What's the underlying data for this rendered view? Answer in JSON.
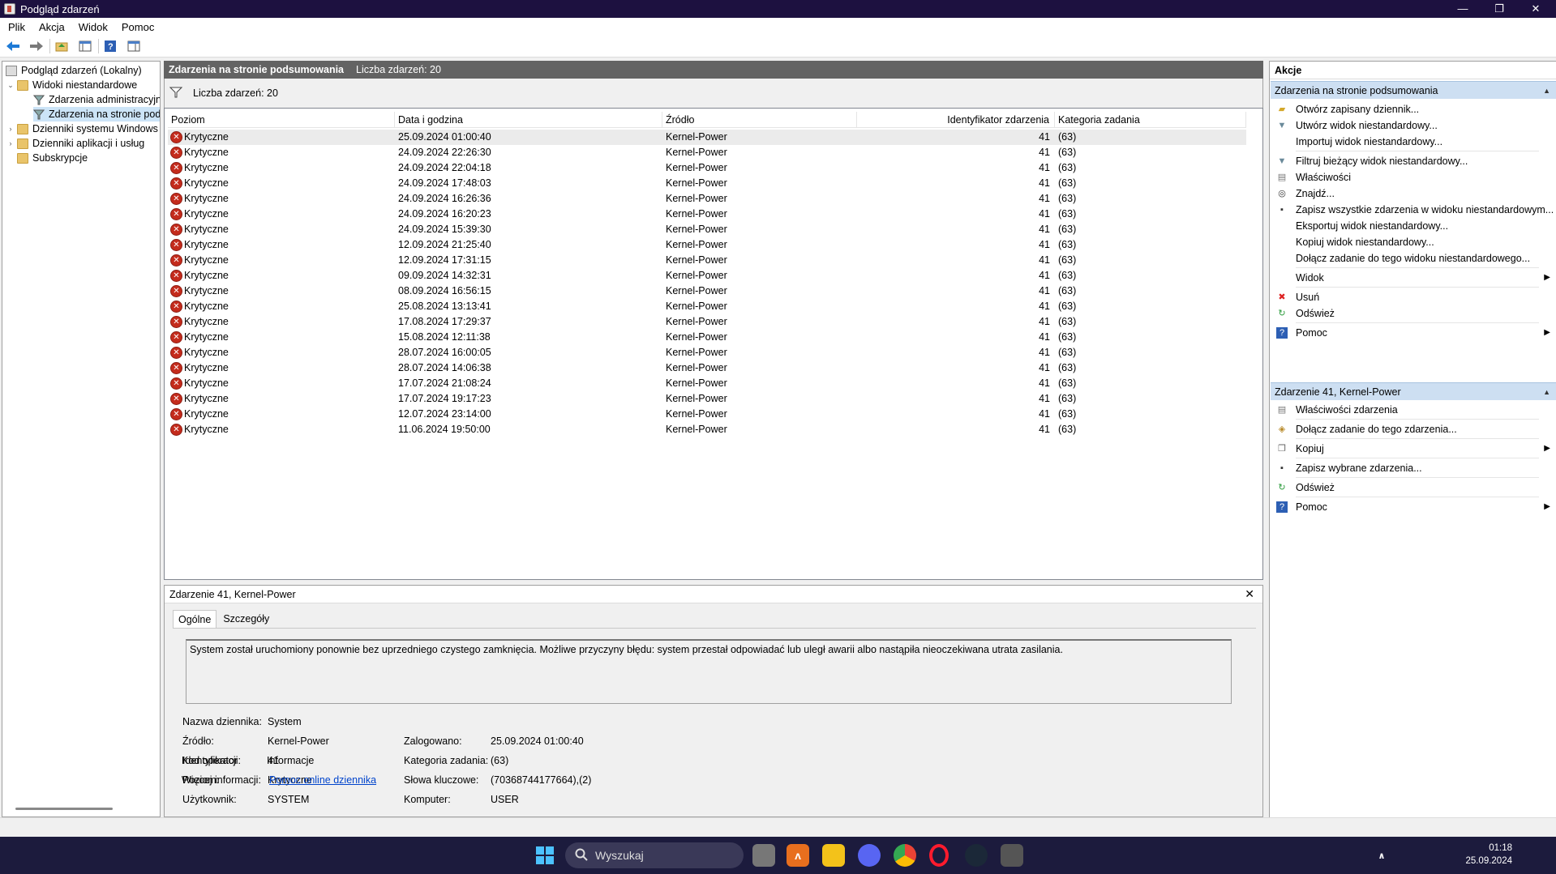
{
  "window": {
    "title": "Podgląd zdarzeń",
    "minimize": "—",
    "maximize": "❐",
    "close": "✕"
  },
  "menu": [
    "Plik",
    "Akcja",
    "Widok",
    "Pomoc"
  ],
  "tree": {
    "root": "Podgląd zdarzeń (Lokalny)",
    "custom_views": "Widoki niestandardowe",
    "admin_events": "Zdarzenia administracyjn",
    "summary_events": "Zdarzenia na stronie pod",
    "windows_logs": "Dzienniki systemu Windows",
    "app_logs": "Dzienniki aplikacji i usług",
    "subscriptions": "Subskrypcje"
  },
  "center": {
    "header_title": "Zdarzenia na stronie podsumowania",
    "header_count": "Liczba zdarzeń: 20",
    "filter_text": "Liczba zdarzeń: 20"
  },
  "columns": [
    "Poziom",
    "Data i godzina",
    "Źródło",
    "Identyfikator zdarzenia",
    "Kategoria zadania"
  ],
  "events": [
    {
      "level": "Krytyczne",
      "datetime": "25.09.2024 01:00:40",
      "source": "Kernel-Power",
      "id": "41",
      "category": "(63)"
    },
    {
      "level": "Krytyczne",
      "datetime": "24.09.2024 22:26:30",
      "source": "Kernel-Power",
      "id": "41",
      "category": "(63)"
    },
    {
      "level": "Krytyczne",
      "datetime": "24.09.2024 22:04:18",
      "source": "Kernel-Power",
      "id": "41",
      "category": "(63)"
    },
    {
      "level": "Krytyczne",
      "datetime": "24.09.2024 17:48:03",
      "source": "Kernel-Power",
      "id": "41",
      "category": "(63)"
    },
    {
      "level": "Krytyczne",
      "datetime": "24.09.2024 16:26:36",
      "source": "Kernel-Power",
      "id": "41",
      "category": "(63)"
    },
    {
      "level": "Krytyczne",
      "datetime": "24.09.2024 16:20:23",
      "source": "Kernel-Power",
      "id": "41",
      "category": "(63)"
    },
    {
      "level": "Krytyczne",
      "datetime": "24.09.2024 15:39:30",
      "source": "Kernel-Power",
      "id": "41",
      "category": "(63)"
    },
    {
      "level": "Krytyczne",
      "datetime": "12.09.2024 21:25:40",
      "source": "Kernel-Power",
      "id": "41",
      "category": "(63)"
    },
    {
      "level": "Krytyczne",
      "datetime": "12.09.2024 17:31:15",
      "source": "Kernel-Power",
      "id": "41",
      "category": "(63)"
    },
    {
      "level": "Krytyczne",
      "datetime": "09.09.2024 14:32:31",
      "source": "Kernel-Power",
      "id": "41",
      "category": "(63)"
    },
    {
      "level": "Krytyczne",
      "datetime": "08.09.2024 16:56:15",
      "source": "Kernel-Power",
      "id": "41",
      "category": "(63)"
    },
    {
      "level": "Krytyczne",
      "datetime": "25.08.2024 13:13:41",
      "source": "Kernel-Power",
      "id": "41",
      "category": "(63)"
    },
    {
      "level": "Krytyczne",
      "datetime": "17.08.2024 17:29:37",
      "source": "Kernel-Power",
      "id": "41",
      "category": "(63)"
    },
    {
      "level": "Krytyczne",
      "datetime": "15.08.2024 12:11:38",
      "source": "Kernel-Power",
      "id": "41",
      "category": "(63)"
    },
    {
      "level": "Krytyczne",
      "datetime": "28.07.2024 16:00:05",
      "source": "Kernel-Power",
      "id": "41",
      "category": "(63)"
    },
    {
      "level": "Krytyczne",
      "datetime": "28.07.2024 14:06:38",
      "source": "Kernel-Power",
      "id": "41",
      "category": "(63)"
    },
    {
      "level": "Krytyczne",
      "datetime": "17.07.2024 21:08:24",
      "source": "Kernel-Power",
      "id": "41",
      "category": "(63)"
    },
    {
      "level": "Krytyczne",
      "datetime": "17.07.2024 19:17:23",
      "source": "Kernel-Power",
      "id": "41",
      "category": "(63)"
    },
    {
      "level": "Krytyczne",
      "datetime": "12.07.2024 23:14:00",
      "source": "Kernel-Power",
      "id": "41",
      "category": "(63)"
    },
    {
      "level": "Krytyczne",
      "datetime": "11.06.2024 19:50:00",
      "source": "Kernel-Power",
      "id": "41",
      "category": "(63)"
    }
  ],
  "detail": {
    "title": "Zdarzenie 41, Kernel-Power",
    "tab_general": "Ogólne",
    "tab_details": "Szczegóły",
    "description": "System został uruchomiony ponownie bez uprzedniego czystego zamknięcia. Możliwe przyczyny błędu: system przestał odpowiadać lub uległ awarii albo nastąpiła nieoczekiwana utrata zasilania.",
    "log_name_label": "Nazwa dziennika:",
    "log_name": "System",
    "source_label": "Źródło:",
    "source": "Kernel-Power",
    "logged_label": "Zalogowano:",
    "logged": "25.09.2024 01:00:40",
    "id_label": "Identyfikator",
    "id": "41",
    "category_label": "Kategoria zadania:",
    "category": "(63)",
    "level_label": "Poziom:",
    "level": "Krytyczne",
    "keywords_label": "Słowa kluczowe:",
    "keywords": "(70368744177664),(2)",
    "user_label": "Użytkownik:",
    "user": "SYSTEM",
    "computer_label": "Komputer:",
    "computer": "USER",
    "opcode_label": "Kod operacji:",
    "opcode": "Informacje",
    "more_info_label": "Więcej informacji:",
    "more_info_link": "Pomoc online dziennika"
  },
  "actions": {
    "header": "Akcje",
    "section1": "Zdarzenia na stronie podsumowania",
    "items1": [
      {
        "label": "Otwórz zapisany dziennik...",
        "icon": "open-folder-icon"
      },
      {
        "label": "Utwórz widok niestandardowy...",
        "icon": "filter-icon"
      },
      {
        "label": "Importuj widok niestandardowy...",
        "icon": ""
      },
      {
        "label": "Filtruj bieżący widok niestandardowy...",
        "icon": "filter-icon"
      },
      {
        "label": "Właściwości",
        "icon": "properties-icon"
      },
      {
        "label": "Znajdź...",
        "icon": "binoculars-icon"
      },
      {
        "label": "Zapisz wszystkie zdarzenia w widoku niestandardowym...",
        "icon": "save-icon"
      },
      {
        "label": "Eksportuj widok niestandardowy...",
        "icon": ""
      },
      {
        "label": "Kopiuj widok niestandardowy...",
        "icon": ""
      },
      {
        "label": "Dołącz zadanie do tego widoku niestandardowego...",
        "icon": ""
      },
      {
        "label": "Widok",
        "icon": "",
        "submenu": true
      },
      {
        "label": "Usuń",
        "icon": "delete-icon"
      },
      {
        "label": "Odśwież",
        "icon": "refresh-icon"
      },
      {
        "label": "Pomoc",
        "icon": "help-icon",
        "submenu": true
      }
    ],
    "section2": "Zdarzenie 41, Kernel-Power",
    "items2": [
      {
        "label": "Właściwości zdarzenia",
        "icon": "properties-icon"
      },
      {
        "label": "Dołącz zadanie do tego zdarzenia...",
        "icon": "task-icon"
      },
      {
        "label": "Kopiuj",
        "icon": "copy-icon",
        "submenu": true
      },
      {
        "label": "Zapisz wybrane zdarzenia...",
        "icon": "save-icon"
      },
      {
        "label": "Odśwież",
        "icon": "refresh-icon"
      },
      {
        "label": "Pomoc",
        "icon": "help-icon",
        "submenu": true
      }
    ]
  },
  "taskbar": {
    "search_placeholder": "Wyszukaj",
    "time": "01:18",
    "date": "25.09.2024"
  },
  "colors": {
    "titlebar": "#1d1140",
    "taskbar": "#1c1b3d",
    "section": "#cddff2",
    "critical": "#c42b1c",
    "link": "#0044cc"
  }
}
